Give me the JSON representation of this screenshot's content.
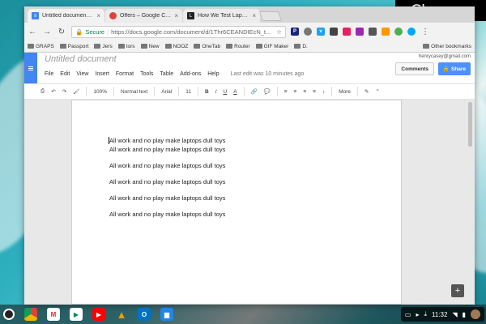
{
  "badge": "Chrome",
  "tabs": [
    {
      "title": "Untitled document - Goo",
      "icon": "docs-icon",
      "color": "#4285f4",
      "glyph": "≡"
    },
    {
      "title": "Offers – Google Chrome",
      "icon": "chrome-icon",
      "color": "#db4437",
      "glyph": "●"
    },
    {
      "title": "How We Test Laptops f",
      "icon": "lifewire-icon",
      "color": "#222",
      "glyph": "L"
    }
  ],
  "omnibox": {
    "secure": "Secure",
    "url": "https://docs.google.com/document/d/1Thr6CEANDIEcN_t..."
  },
  "bookmarks": [
    "GRAPS",
    "Passport",
    "Jers",
    "tors",
    "New",
    "NOOZ",
    "OneTab",
    "Router",
    "GIF Maker",
    "D."
  ],
  "other_bookmarks": "Other bookmarks",
  "doc": {
    "title": "Untitled document",
    "email": "henrycasey@gmail.com",
    "comments": "Comments",
    "share": "Share",
    "menus": [
      "File",
      "Edit",
      "View",
      "Insert",
      "Format",
      "Tools",
      "Table",
      "Add-ons",
      "Help"
    ],
    "last_edit": "Last edit was 10 minutes ago"
  },
  "toolbar": {
    "zoom": "100%",
    "style": "Normal text",
    "font": "Arial",
    "size": "11",
    "more": "More"
  },
  "body_lines": [
    "All work and no play make laptops dull toys",
    "All work and no play make laptops dull toys",
    "All work and no play make laptops dull toys",
    "All work and no play make laptops dull toys",
    "All work and no play make laptops dull toys",
    "All work and no play make laptops dull toys"
  ],
  "shelf": {
    "time": "11:32"
  }
}
